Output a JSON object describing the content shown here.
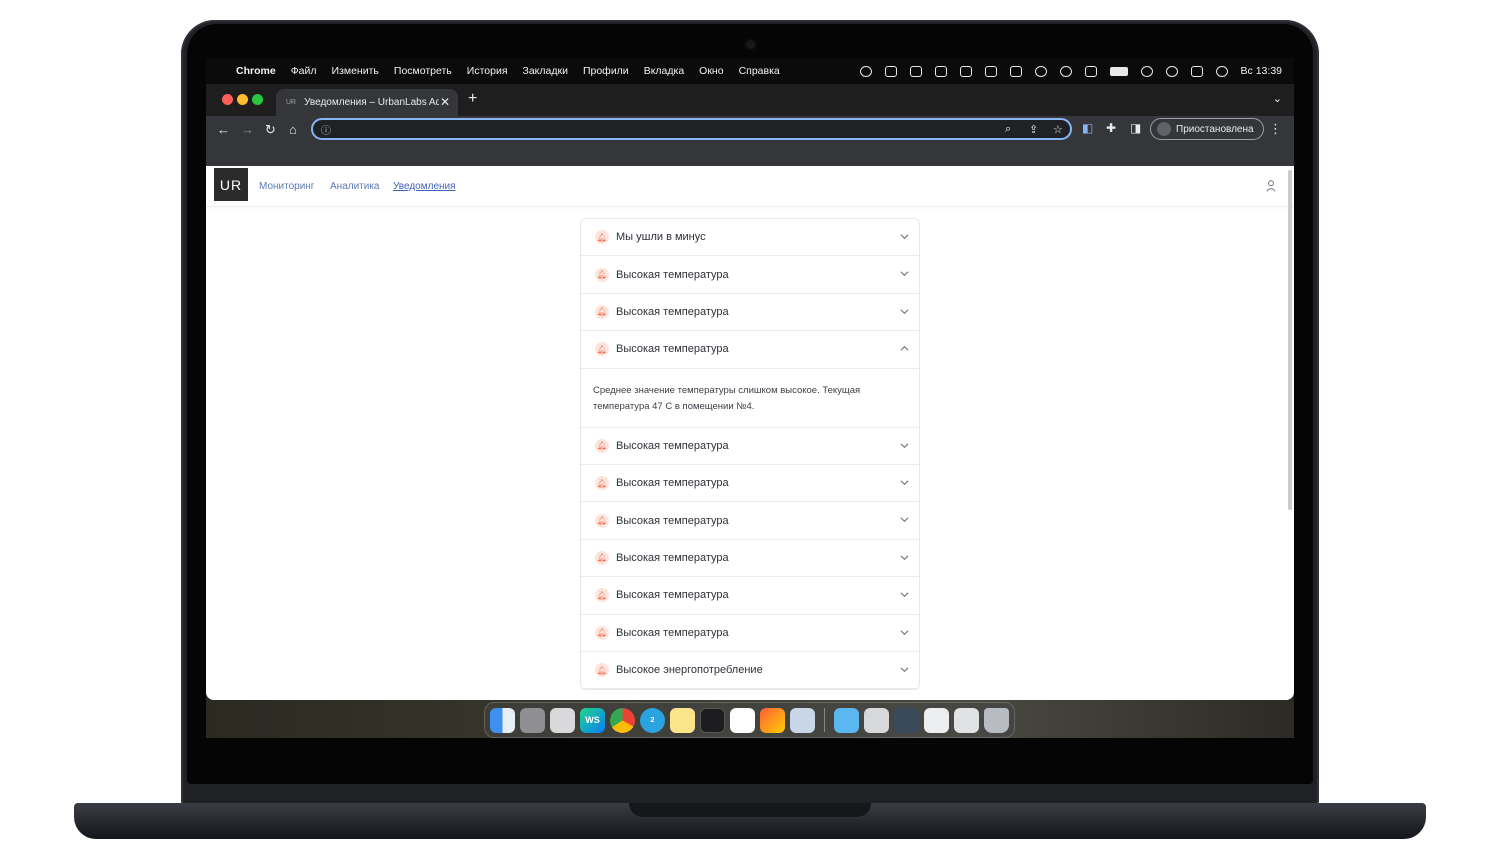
{
  "menubar": {
    "app": "Chrome",
    "items": [
      "Файл",
      "Изменить",
      "Посмотреть",
      "История",
      "Закладки",
      "Профили",
      "Вкладка",
      "Окно",
      "Справка"
    ],
    "clock": "Вс 13:39"
  },
  "browser": {
    "tab_title": "Уведомления – UrbanLabs Ad",
    "tab_favicon": "UR",
    "address_value": "",
    "profile_status": "Приостановлена"
  },
  "app": {
    "logo": "UR",
    "nav": [
      "Мониторинг",
      "Аналитика",
      "Уведомления"
    ],
    "active_nav": "Уведомления"
  },
  "notifications": [
    {
      "title": "Мы ушли в минус",
      "expanded": false
    },
    {
      "title": "Высокая температура",
      "expanded": false
    },
    {
      "title": "Высокая температура",
      "expanded": false
    },
    {
      "title": "Высокая температура",
      "expanded": true,
      "detail": "Среднее значение температуры слишком высокое. Текущая температура 47 С в помещении №4."
    },
    {
      "title": "Высокая температура",
      "expanded": false
    },
    {
      "title": "Высокая температура",
      "expanded": false
    },
    {
      "title": "Высокая температура",
      "expanded": false
    },
    {
      "title": "Высокая температура",
      "expanded": false
    },
    {
      "title": "Высокая температура",
      "expanded": false
    },
    {
      "title": "Высокая температура",
      "expanded": false
    },
    {
      "title": "Высокое энергопотребление",
      "expanded": false
    }
  ],
  "colors": {
    "accent": "#3f63b8",
    "bell_bg": "#fde4dc",
    "bell_fg": "#ef6a4a"
  },
  "dock": [
    "finder-icon",
    "launchpad-icon",
    "screenshot-icon",
    "webstorm-icon",
    "chrome-icon",
    "telegram-icon",
    "notes-icon",
    "terminal-icon",
    "slack-icon",
    "pixelmator-icon",
    "preview-icon",
    "folder-icon",
    "window-icon",
    "window-icon",
    "window-icon",
    "window-icon",
    "trash-icon"
  ],
  "dock_labels": {
    "webstorm": "WS",
    "telegram_badge": "2"
  }
}
